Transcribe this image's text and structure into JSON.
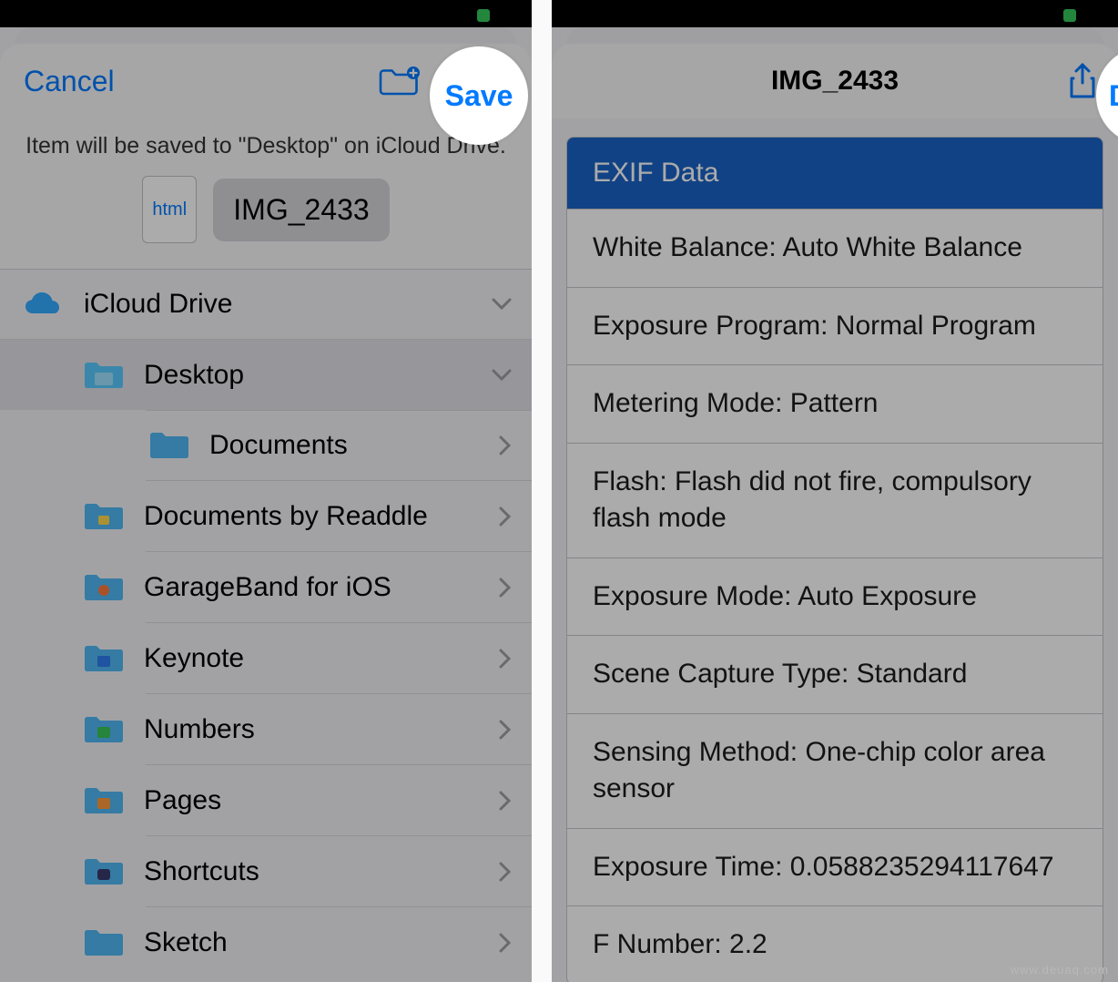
{
  "left": {
    "nav": {
      "cancel": "Cancel",
      "save": "Save"
    },
    "subtitle": "Item will be saved to \"Desktop\" on iCloud Drive.",
    "doc_kind": "html",
    "filename": "IMG_2433",
    "root": {
      "label": "iCloud Drive"
    },
    "selected": {
      "label": "Desktop"
    },
    "folders": [
      {
        "label": "Documents"
      },
      {
        "label": "Documents by Readdle"
      },
      {
        "label": "GarageBand for iOS"
      },
      {
        "label": "Keynote"
      },
      {
        "label": "Numbers"
      },
      {
        "label": "Pages"
      },
      {
        "label": "Shortcuts"
      },
      {
        "label": "Sketch"
      }
    ]
  },
  "right": {
    "nav": {
      "done": "Done",
      "title": "IMG_2433"
    },
    "exif_header": "EXIF Data",
    "exif": [
      "White Balance: Auto White Balance",
      "Exposure Program: Normal Program",
      "Metering Mode: Pattern",
      "Flash: Flash did not fire, compulsory flash mode",
      "Exposure Mode: Auto Exposure",
      "Scene Capture Type: Standard",
      "Sensing Method: One-chip color area sensor",
      "Exposure Time: 0.0588235294117647",
      "F Number: 2.2"
    ]
  },
  "watermark": "www.deuaq.com"
}
